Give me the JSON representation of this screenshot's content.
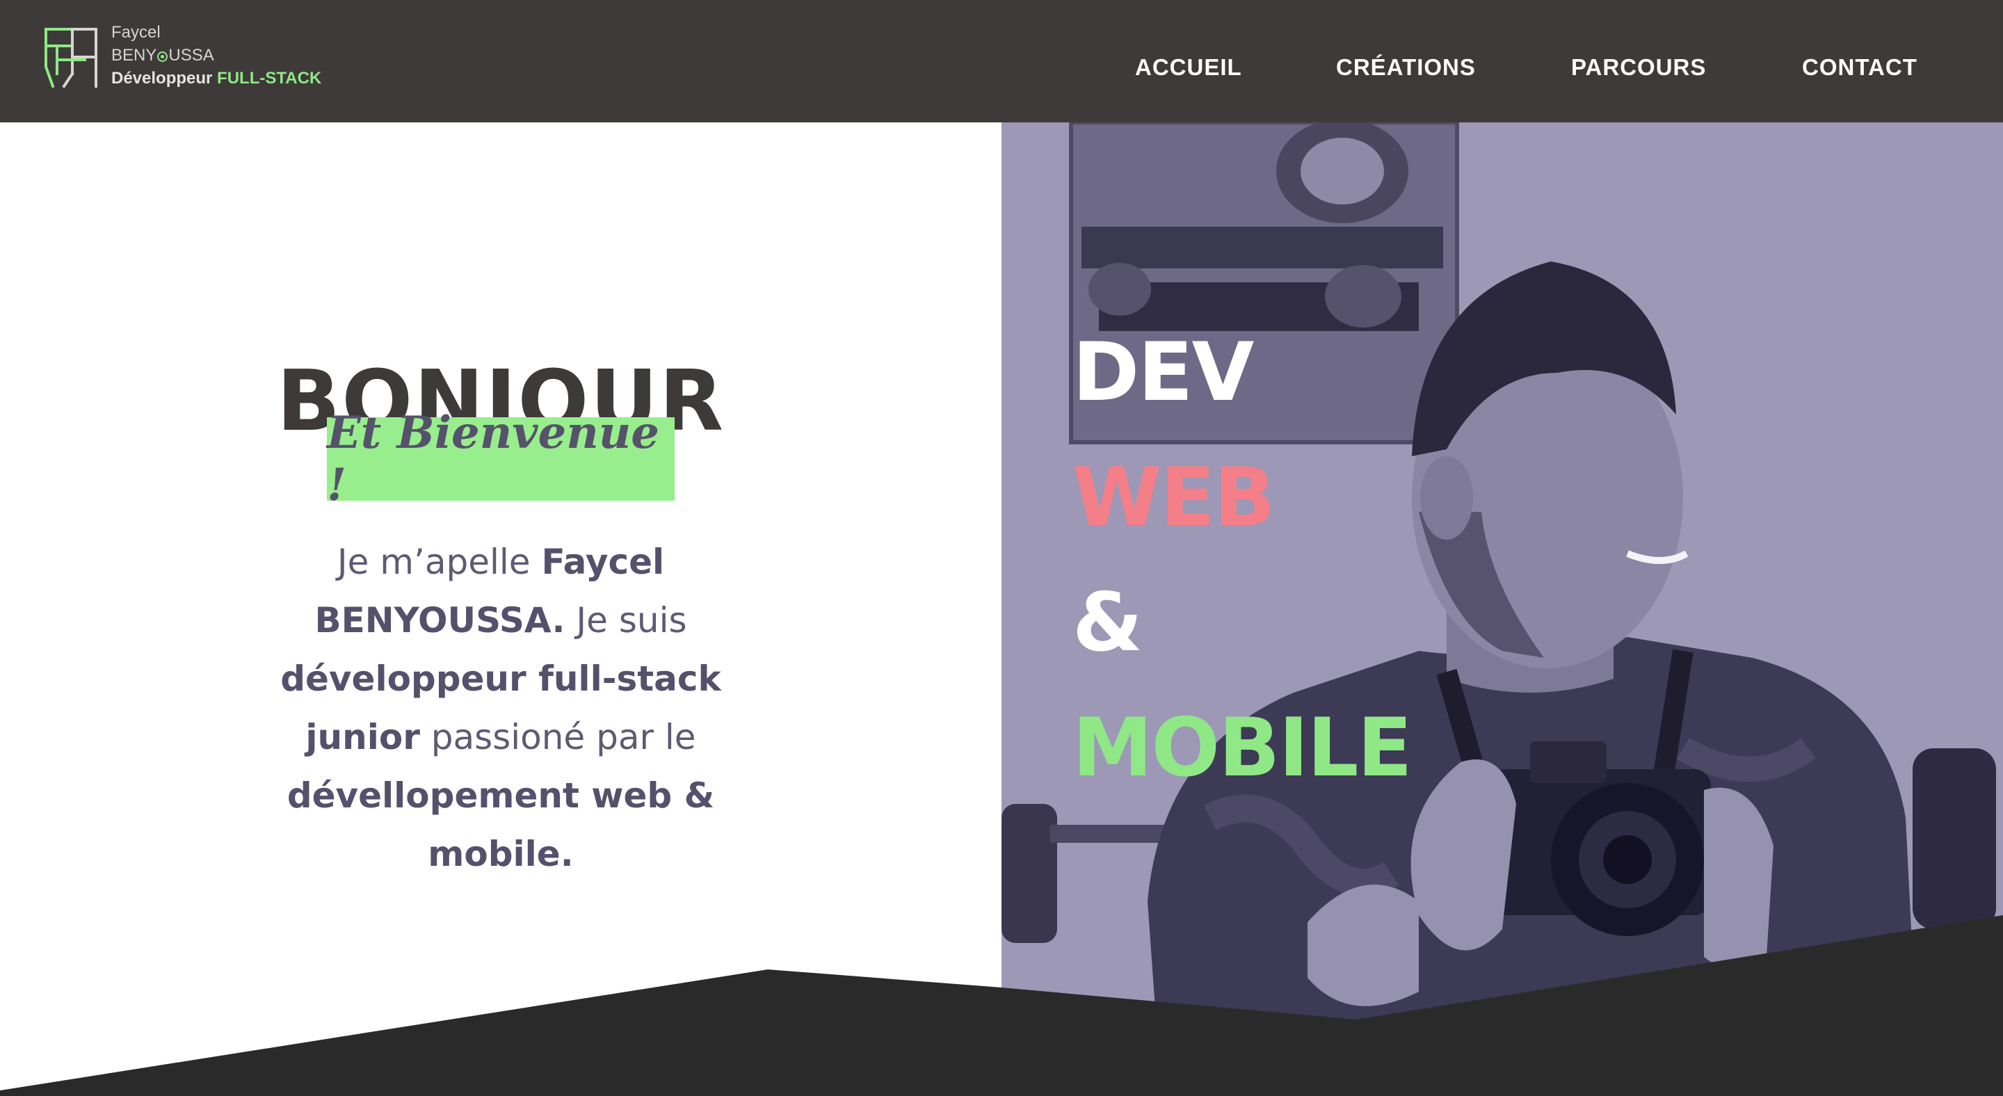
{
  "brand": {
    "first_name": "Faycel",
    "last_name_start": "BENY",
    "last_name_end": "USSA",
    "role_prefix": "Développeur",
    "role_accent": "FULL-STACK"
  },
  "nav": {
    "items": [
      {
        "label": "ACCUEIL"
      },
      {
        "label": "CRÉATIONS"
      },
      {
        "label": "PARCOURS"
      },
      {
        "label": "CONTACT"
      }
    ]
  },
  "hero": {
    "greeting": "BONJOUR",
    "welcome": "Et Bienvenue !",
    "intro": [
      {
        "text": "Je m’apelle ",
        "bold": false
      },
      {
        "text": "Faycel BENYOUSSA.",
        "bold": true
      },
      {
        "text": " Je suis ",
        "bold": false
      },
      {
        "text": "développeur full-stack junior",
        "bold": true
      },
      {
        "text": " passioné par le ",
        "bold": false
      },
      {
        "text": "dévellopement web & mobile.",
        "bold": true
      }
    ],
    "tagline": {
      "line1": "DEV",
      "line2": "WEB",
      "line3": "&",
      "line4": "MOBILE"
    }
  },
  "colors": {
    "header_bg": "#3e3a39",
    "accent_green": "#98ee8c",
    "accent_pink": "#f47f88",
    "text_purple": "#5e5a74",
    "photo_tint": "#9c98b6",
    "footer_band": "#2b2a2a"
  },
  "icons": {
    "logo": "fb-monogram-logo-icon"
  }
}
